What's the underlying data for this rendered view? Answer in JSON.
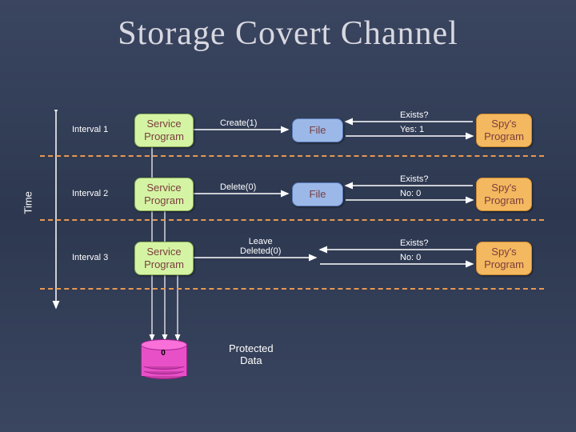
{
  "title": "Storage Covert Channel",
  "time_axis_label": "Time",
  "intervals": [
    {
      "label": "Interval 1"
    },
    {
      "label": "Interval 2"
    },
    {
      "label": "Interval 3"
    }
  ],
  "service_box_label": "Service\nProgram",
  "spy_box_label": "Spy's\nProgram",
  "file_box_label": "File",
  "rows": [
    {
      "op": "Create(1)",
      "exists_q": "Exists?",
      "answer": "Yes: 1",
      "has_file": true
    },
    {
      "op": "Delete(0)",
      "exists_q": "Exists?",
      "answer": "No: 0",
      "has_file": true
    },
    {
      "op": "Leave\nDeleted(0)",
      "exists_q": "Exists?",
      "answer": "No: 0",
      "has_file": false
    }
  ],
  "cylinder_text": "0",
  "protected_label": "Protected\nData"
}
